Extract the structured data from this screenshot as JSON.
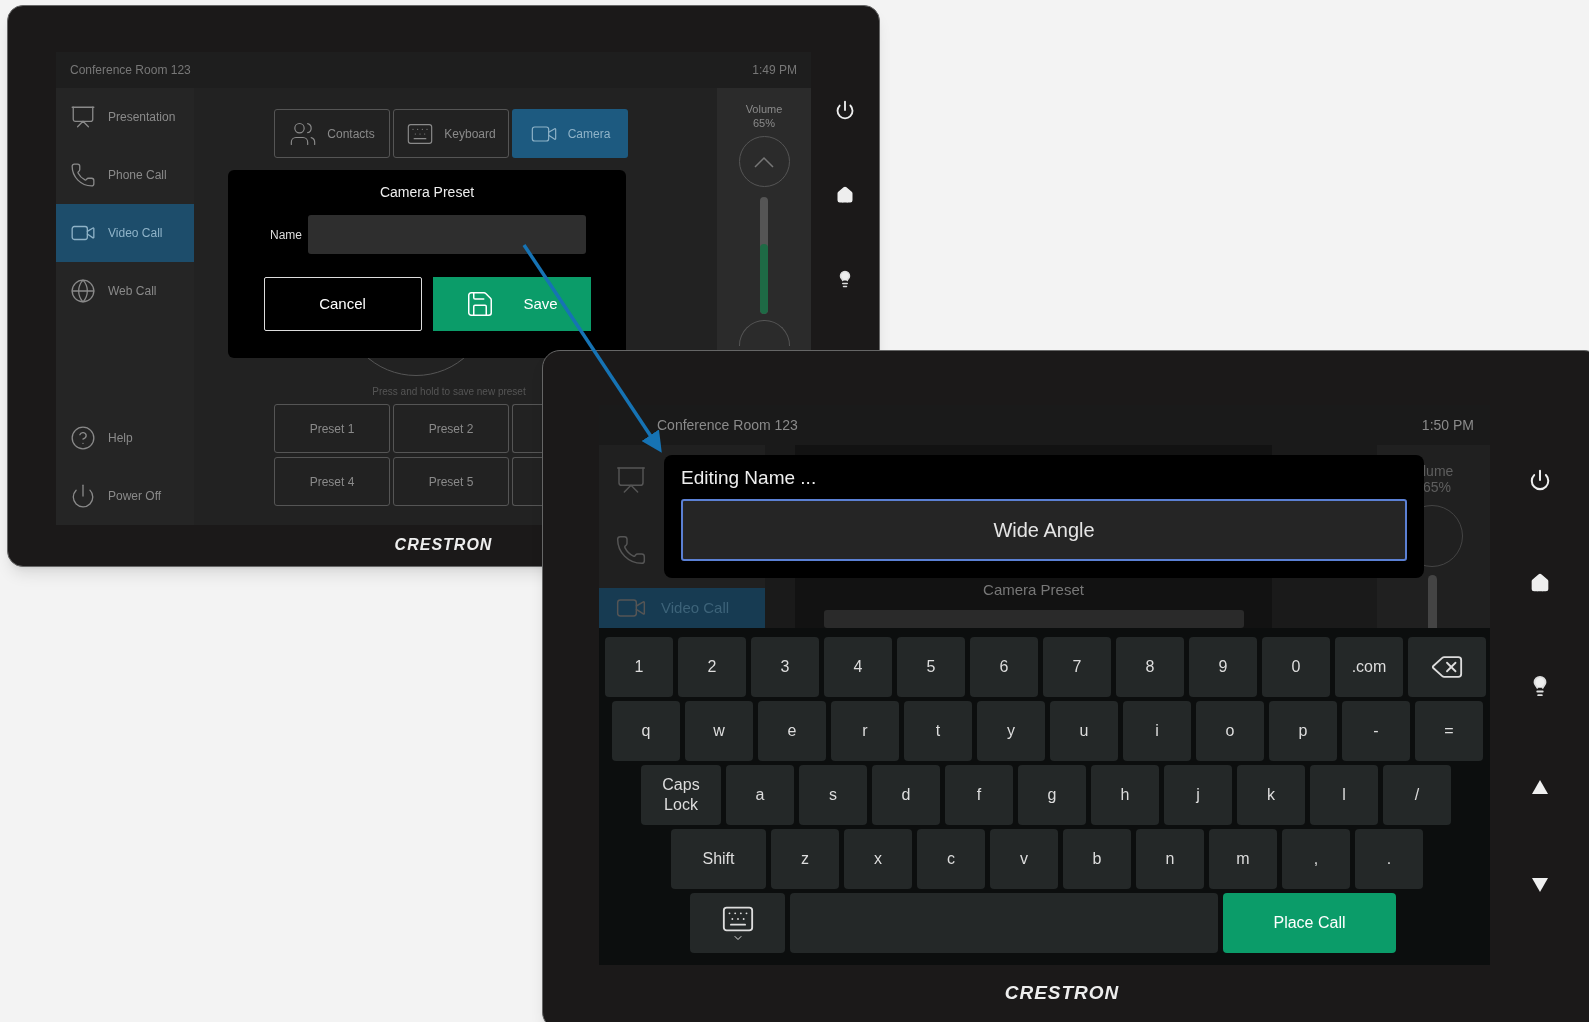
{
  "left_panel": {
    "header": {
      "title": "Conference Room 123",
      "time": "1:49 PM"
    },
    "sidebar": [
      {
        "label": "Presentation",
        "selected": false
      },
      {
        "label": "Phone Call",
        "selected": false
      },
      {
        "label": "Video Call",
        "selected": true
      },
      {
        "label": "Web Call",
        "selected": false
      }
    ],
    "sidebar_bottom": [
      {
        "label": "Help"
      },
      {
        "label": "Power Off"
      }
    ],
    "tabs": [
      {
        "label": "Contacts",
        "selected": false
      },
      {
        "label": "Keyboard",
        "selected": false
      },
      {
        "label": "Camera",
        "selected": true
      }
    ],
    "hint": "Press and hold to save new preset",
    "presets": [
      [
        "Preset 1",
        "Preset 2"
      ],
      [
        "Preset 4",
        "Preset 5"
      ]
    ],
    "volume": {
      "label": "Volume",
      "reading": "65%",
      "level": 0.6
    },
    "dialog": {
      "title": "Camera Preset",
      "field_label": "Name",
      "buttons": [
        {
          "label": "Cancel",
          "kind": "outline"
        },
        {
          "label": "Save",
          "kind": "primary"
        }
      ]
    },
    "brand": "CRESTRON"
  },
  "right_panel": {
    "header": {
      "title": "Conference Room 123",
      "time": "1:50 PM"
    },
    "sidebar": [
      {
        "selected": false
      },
      {
        "selected": false
      },
      {
        "label": "Video Call",
        "selected": true
      }
    ],
    "background_title": "Camera Preset",
    "volume": {
      "label": "lume",
      "reading": "65%"
    },
    "editor": {
      "title": "Editing Name ...",
      "value": "Wide Angle"
    },
    "keyboard": [
      [
        {
          "kind": "key",
          "label": "1"
        },
        {
          "kind": "key",
          "label": "2"
        },
        {
          "kind": "key",
          "label": "3"
        },
        {
          "kind": "key",
          "label": "4"
        },
        {
          "kind": "key",
          "label": "5"
        },
        {
          "kind": "key",
          "label": "6"
        },
        {
          "kind": "key",
          "label": "7"
        },
        {
          "kind": "key",
          "label": "8"
        },
        {
          "kind": "key",
          "label": "9"
        },
        {
          "kind": "key",
          "label": "0"
        },
        {
          "kind": "key",
          "label": ".com"
        },
        {
          "kind": "backspace"
        }
      ],
      [
        {
          "kind": "key",
          "label": "q"
        },
        {
          "kind": "key",
          "label": "w"
        },
        {
          "kind": "key",
          "label": "e"
        },
        {
          "kind": "key",
          "label": "r"
        },
        {
          "kind": "key",
          "label": "t"
        },
        {
          "kind": "key",
          "label": "y"
        },
        {
          "kind": "key",
          "label": "u"
        },
        {
          "kind": "key",
          "label": "i"
        },
        {
          "kind": "key",
          "label": "o"
        },
        {
          "kind": "key",
          "label": "p"
        },
        {
          "kind": "key",
          "label": "-"
        },
        {
          "kind": "key",
          "label": "="
        }
      ],
      [
        {
          "kind": "wide",
          "label": "Caps Lock"
        },
        {
          "kind": "key",
          "label": "a"
        },
        {
          "kind": "key",
          "label": "s"
        },
        {
          "kind": "key",
          "label": "d"
        },
        {
          "kind": "key",
          "label": "f"
        },
        {
          "kind": "key",
          "label": "g"
        },
        {
          "kind": "key",
          "label": "h"
        },
        {
          "kind": "key",
          "label": "j"
        },
        {
          "kind": "key",
          "label": "k"
        },
        {
          "kind": "key",
          "label": "l"
        },
        {
          "kind": "key",
          "label": "/"
        }
      ],
      [
        {
          "kind": "shift",
          "label": "Shift"
        },
        {
          "kind": "key",
          "label": "z"
        },
        {
          "kind": "key",
          "label": "x"
        },
        {
          "kind": "key",
          "label": "c"
        },
        {
          "kind": "key",
          "label": "v"
        },
        {
          "kind": "key",
          "label": "b"
        },
        {
          "kind": "key",
          "label": "n"
        },
        {
          "kind": "key",
          "label": "m"
        },
        {
          "kind": "key",
          "label": ","
        },
        {
          "kind": "key",
          "label": "."
        }
      ],
      [
        {
          "kind": "hide"
        },
        {
          "kind": "space"
        },
        {
          "kind": "action",
          "label": "Place Call"
        }
      ]
    ],
    "brand": "CRESTRON"
  }
}
